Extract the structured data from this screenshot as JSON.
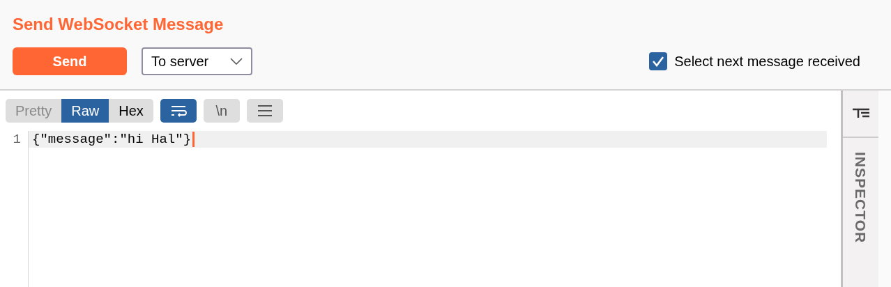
{
  "title": "Send WebSocket Message",
  "send_button": "Send",
  "direction": {
    "value": "To server"
  },
  "select_next": {
    "label": "Select next message received",
    "checked": true
  },
  "view_tabs": [
    {
      "label": "Pretty",
      "selected": false
    },
    {
      "label": "Raw",
      "selected": true
    },
    {
      "label": "Hex",
      "selected": false
    }
  ],
  "toolbar": [
    {
      "kind": "wrap",
      "selected": true
    },
    {
      "kind": "newline",
      "label": "\\n",
      "selected": false
    },
    {
      "kind": "menu",
      "selected": false
    }
  ],
  "editor": {
    "lines": [
      {
        "number": "1",
        "text": "{\"message\":\"hi Hal\"}"
      }
    ]
  },
  "inspector": {
    "label": "INSPECTOR"
  }
}
